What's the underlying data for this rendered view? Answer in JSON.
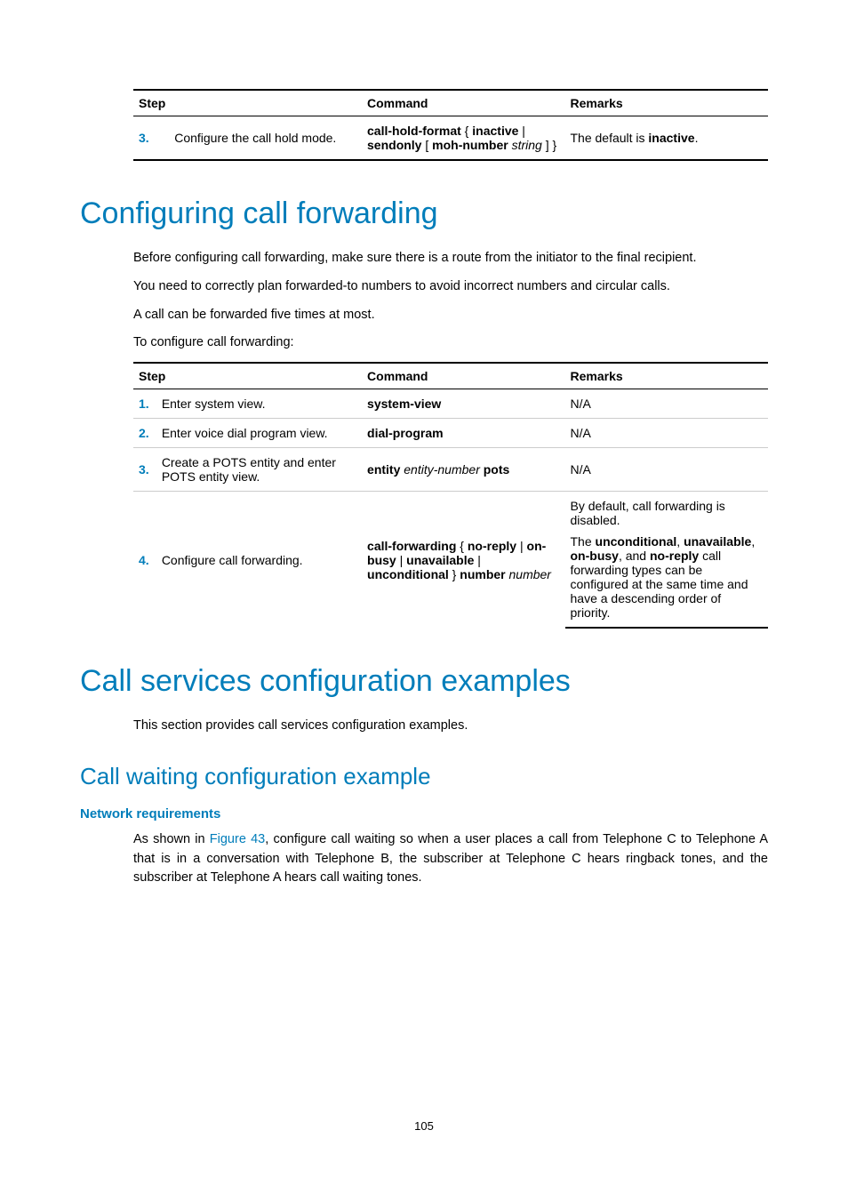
{
  "table1": {
    "h1": "Step",
    "h2": "Command",
    "h3": "Remarks",
    "step_num": "3.",
    "step_text": "Configure the call hold mode.",
    "cmd_p1": "call-hold-format",
    "cmd_p2": " { ",
    "cmd_p3": "inactive",
    "cmd_p4": " | ",
    "cmd_p5": "sendonly",
    "cmd_p6": " [ ",
    "cmd_p7": "moh-number",
    "cmd_p8": " ",
    "cmd_arg": "string",
    "cmd_p9": " ] }",
    "rem_p1": "The default is ",
    "rem_p2": "inactive",
    "rem_p3": "."
  },
  "heading1": "Configuring call forwarding",
  "para1": "Before configuring call forwarding, make sure there is a route from the initiator to the final recipient.",
  "para2": "You need to correctly plan forwarded-to numbers to avoid incorrect numbers and circular calls.",
  "para3": "A call can be forwarded five times at most.",
  "para4": "To configure call forwarding:",
  "table2": {
    "h1": "Step",
    "h2": "Command",
    "h3": "Remarks",
    "r1": {
      "num": "1.",
      "step": "Enter system view.",
      "cmd": "system-view",
      "rem": "N/A"
    },
    "r2": {
      "num": "2.",
      "step": "Enter voice dial program view.",
      "cmd": "dial-program",
      "rem": "N/A"
    },
    "r3": {
      "num": "3.",
      "step": "Create a POTS entity and enter POTS entity view.",
      "cmd_a": "entity",
      "cmd_b": "entity-number",
      "cmd_c": "pots",
      "rem": "N/A"
    },
    "r4": {
      "num": "4.",
      "step": "Configure call forwarding.",
      "cmd_a": "call-forwarding",
      "cmd_b": " { ",
      "cmd_c": "no-reply",
      "cmd_d": " | ",
      "cmd_e": "on-busy",
      "cmd_f": " | ",
      "cmd_g": "unavailable",
      "cmd_h": " | ",
      "cmd_i": "unconditional",
      "cmd_j": " } ",
      "cmd_k": "number",
      "cmd_l": "number",
      "rem_a": "By default, call forwarding is disabled.",
      "rem_b1": "The ",
      "rem_b2": "unconditional",
      "rem_b3": ", ",
      "rem_b4": "unavailable",
      "rem_b5": ", ",
      "rem_b6": "on-busy",
      "rem_b7": ", and ",
      "rem_b8": "no-reply",
      "rem_b9": " call forwarding types can be configured at the same time and have a descending order of priority."
    }
  },
  "heading2": "Call services configuration examples",
  "para5": "This section provides call services configuration examples.",
  "heading3": "Call waiting configuration example",
  "heading4": "Network requirements",
  "para6_a": "As shown in ",
  "para6_link": "Figure 43",
  "para6_b": ", configure call waiting so when a user places a call from Telephone C to Telephone A that is in a conversation with Telephone B, the subscriber at Telephone C hears ringback tones, and the subscriber at Telephone A hears call waiting tones.",
  "pagenum": "105"
}
